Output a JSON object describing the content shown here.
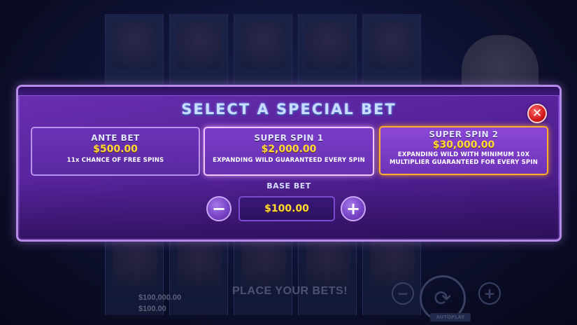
{
  "modal": {
    "title": "SELECT A SPECIAL BET",
    "close_symbol": "✕",
    "options": [
      {
        "title": "ANTE BET",
        "price": "$500.00",
        "description_lines": [
          "11x CHANCE OF FREE SPINS"
        ]
      },
      {
        "title": "SUPER SPIN 1",
        "price": "$2,000.00",
        "description_lines": [
          "EXPANDING WILD GUARANTEED EVERY SPIN"
        ]
      },
      {
        "title": "SUPER SPIN 2",
        "price": "$30,000.00",
        "description_lines": [
          "EXPANDING WILD WITH MINIMUM 10X",
          "MULTIPLIER GUARANTEED FOR EVERY SPIN"
        ]
      }
    ],
    "base_bet": {
      "label": "BASE BET",
      "value": "$100.00",
      "minus_symbol": "−",
      "plus_symbol": "+"
    }
  },
  "background": {
    "credit_value": "$100,000.00",
    "bet_value": "$100.00",
    "place_bets_text": "PLACE YOUR BETS!",
    "autoplay_label": "AUTOPLAY"
  },
  "colors": {
    "modal_purple": "#5a25a0",
    "price_yellow": "#ffd83a",
    "selected_border": "#ffae2a",
    "close_red": "#d01818"
  },
  "icons": {
    "close": "close-icon",
    "minus": "minus-icon",
    "plus": "plus-icon",
    "spin": "spin-icon"
  }
}
